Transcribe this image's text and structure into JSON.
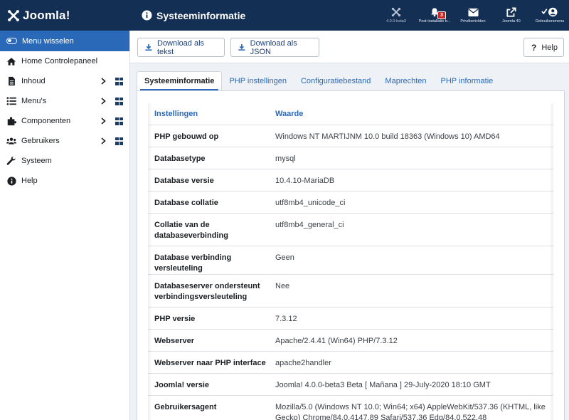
{
  "header": {
    "logo_text": "Joomla!",
    "page_title": "Systeeminformatie",
    "items": [
      {
        "label": "4.0.0-beta3",
        "icon": "joomla-icon"
      },
      {
        "label": "Post-installatie b...",
        "icon": "bell-icon",
        "badge": "3"
      },
      {
        "label": "Privéberichten",
        "icon": "envelope-icon"
      },
      {
        "label": "Joomla 40",
        "icon": "external-link-icon"
      },
      {
        "label": "Gebruikersmenu",
        "icon": "user-icon"
      }
    ]
  },
  "sidebar": {
    "toggle_label": "Menu wisselen",
    "items": [
      {
        "label": "Home Controlepaneel",
        "icon": "home-icon"
      },
      {
        "label": "Inhoud",
        "icon": "file-icon"
      },
      {
        "label": "Menu's",
        "icon": "list-icon"
      },
      {
        "label": "Componenten",
        "icon": "puzzle-icon"
      },
      {
        "label": "Gebruikers",
        "icon": "users-icon"
      },
      {
        "label": "Systeem",
        "icon": "wrench-icon"
      },
      {
        "label": "Help",
        "icon": "info-icon"
      }
    ]
  },
  "toolbar": {
    "download_text": "Download als tekst",
    "download_json": "Download als JSON",
    "help": "Help"
  },
  "tabs": [
    {
      "label": "Systeeminformatie",
      "active": true
    },
    {
      "label": "PHP instellingen",
      "active": false
    },
    {
      "label": "Configuratiebestand",
      "active": false
    },
    {
      "label": "Maprechten",
      "active": false
    },
    {
      "label": "PHP informatie",
      "active": false
    }
  ],
  "table": {
    "headers": [
      "Instellingen",
      "Waarde"
    ],
    "rows": [
      {
        "key": "PHP gebouwd op",
        "value": "Windows NT MARTIJNM 10.0 build 18363 (Windows 10) AMD64"
      },
      {
        "key": "Databasetype",
        "value": "mysql"
      },
      {
        "key": "Database versie",
        "value": "10.4.10-MariaDB"
      },
      {
        "key": "Database collatie",
        "value": "utf8mb4_unicode_ci"
      },
      {
        "key": "Collatie van de databaseverbinding",
        "value": "utf8mb4_general_ci"
      },
      {
        "key": "Database verbinding versleuteling",
        "value": "Geen"
      },
      {
        "key": "Databaseserver ondersteunt verbindingsversleuteling",
        "value": "Nee"
      },
      {
        "key": "PHP versie",
        "value": "7.3.12"
      },
      {
        "key": "Webserver",
        "value": "Apache/2.4.41 (Win64) PHP/7.3.12"
      },
      {
        "key": "Webserver naar PHP interface",
        "value": "apache2handler"
      },
      {
        "key": "Joomla! versie",
        "value": "Joomla! 4.0.0-beta3 Beta [ Mañana ] 29-July-2020 18:10 GMT"
      },
      {
        "key": "Gebruikersagent",
        "value": "Mozilla/5.0 (Windows NT 10.0; Win64; x64) AppleWebKit/537.36 (KHTML, like Gecko) Chrome/84.0.4147.89 Safari/537.36 Edg/84.0.522.48"
      }
    ]
  },
  "colors": {
    "header_bg": "#132f53",
    "accent": "#2a69b8",
    "badge": "#c52827"
  }
}
